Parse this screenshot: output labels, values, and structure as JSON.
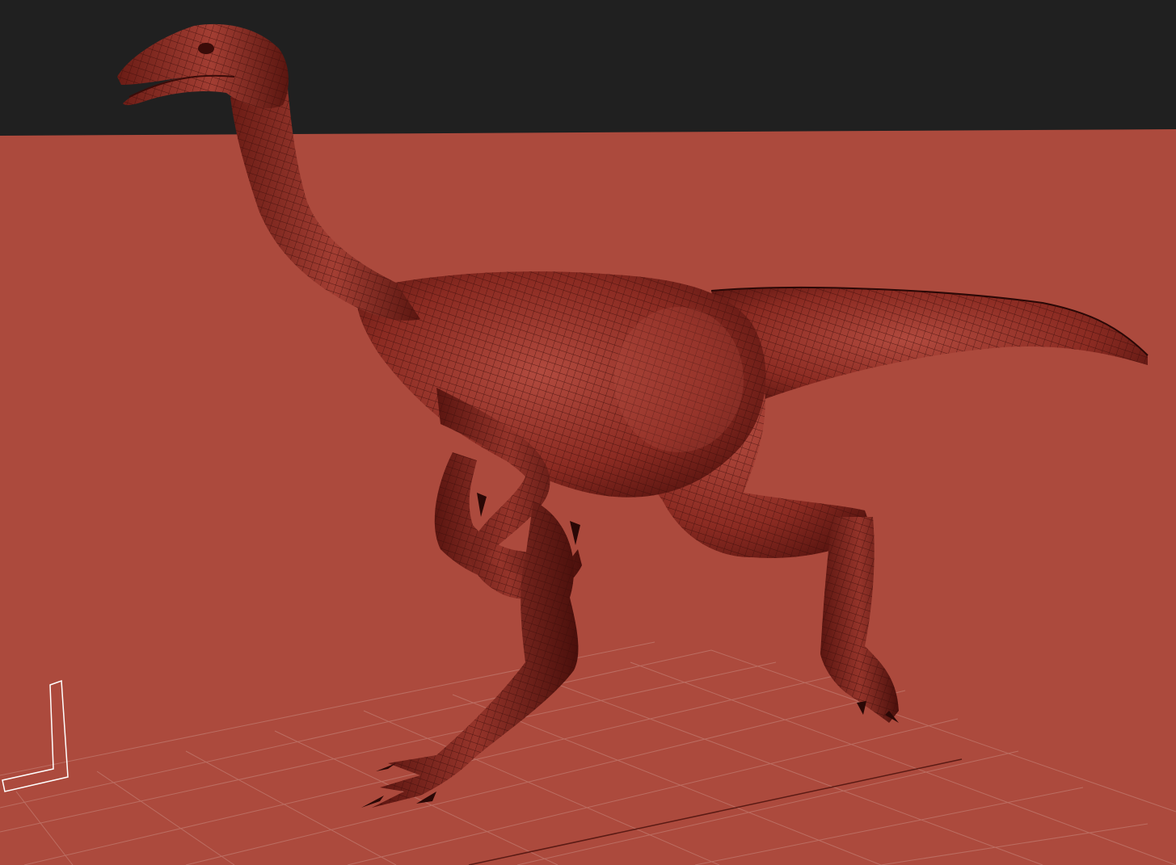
{
  "viewport": {
    "background_top_color": "#202020",
    "background_floor_color": "#ac4a3d",
    "grid_color": "#c98a80",
    "mesh_fill_color": "#8e2a22",
    "mesh_highlight_color": "#b64a3e",
    "mesh_wire_color": "#3a0c09",
    "axis_gizmo_color": "#ffffff",
    "object": "dinosaur-mesh",
    "display_mode": "wireframe-on-shaded"
  }
}
